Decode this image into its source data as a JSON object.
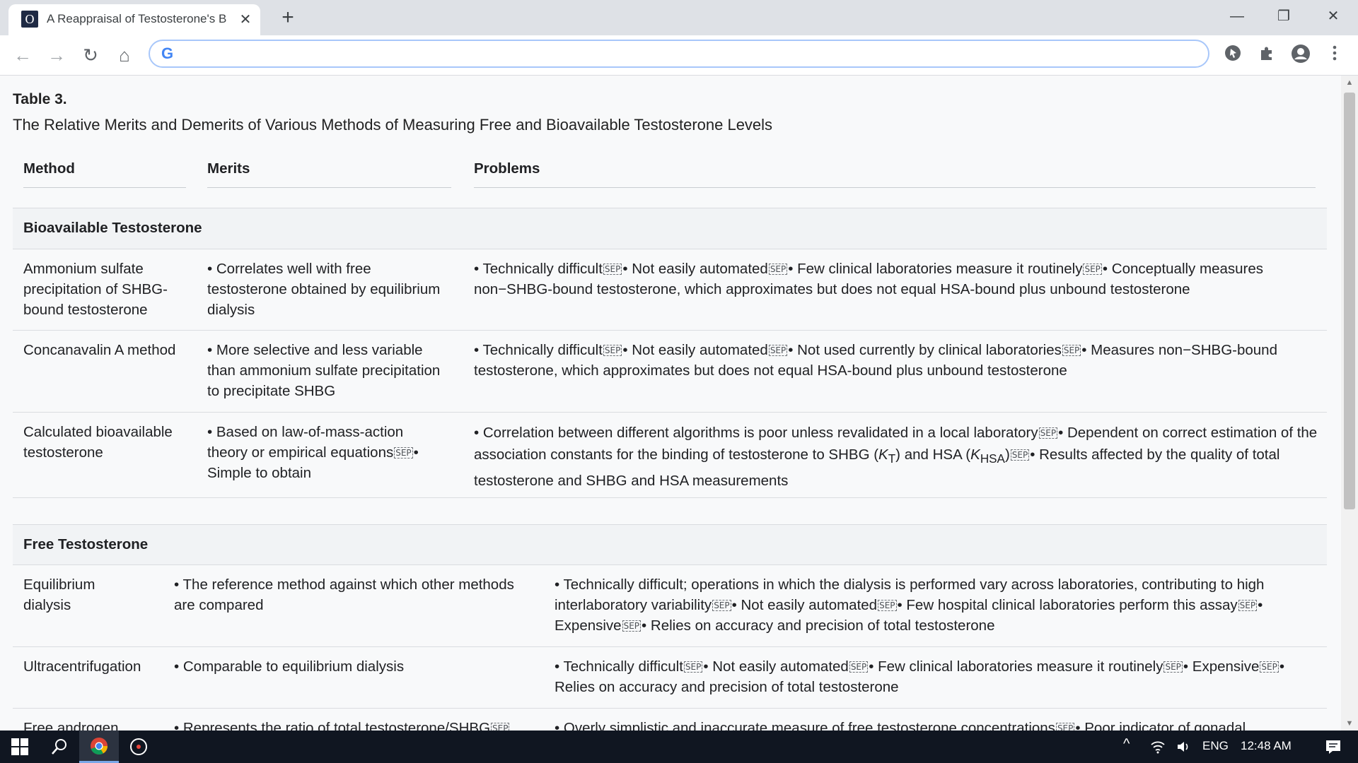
{
  "browser": {
    "tab": {
      "favicon_letter": "O",
      "title": "A Reappraisal of Testosterone's B",
      "close_glyph": "✕"
    },
    "new_tab_glyph": "+",
    "window_controls": {
      "minimize_glyph": "—",
      "restore_glyph": "❐",
      "close_glyph": "✕"
    },
    "nav": {
      "back_glyph": "←",
      "forward_glyph": "→",
      "reload_glyph": "↻",
      "home_glyph": "⌂"
    },
    "omnibox": {
      "google_glyph": "G",
      "value": "",
      "placeholder": ""
    },
    "toolbar_icons": [
      "cursor-extension-icon",
      "puzzle-icon",
      "profile-icon",
      "kebab-menu-icon"
    ]
  },
  "page": {
    "table_title": "Table 3.",
    "table_caption": "The Relative Merits and Demerits of Various Methods of Measuring Free and Bioavailable Testosterone Levels",
    "headers": {
      "method": "Method",
      "merits": "Merits",
      "problems": "Problems"
    },
    "sep_glyph": "SEP",
    "sections": [
      {
        "label": "Bioavailable Testosterone",
        "rows": [
          {
            "method": "Ammonium sulfate precipitation of SHBG-bound testosterone",
            "merits": [
              "Correlates well with free testosterone obtained by equilibrium dialysis"
            ],
            "problems": [
              "Technically difficult",
              "Not easily automated",
              "Few clinical laboratories measure it routinely",
              "Conceptually measures non−SHBG-bound testosterone, which approximates but does not equal HSA-bound plus unbound testosterone"
            ]
          },
          {
            "method": "Concanavalin A method",
            "merits": [
              "More selective and less variable than ammonium sulfate precipitation to precipitate SHBG"
            ],
            "problems": [
              "Technically difficult",
              "Not easily automated",
              "Not used currently by clinical laboratories",
              "Measures non−SHBG-bound testosterone, which approximates but does not equal HSA-bound plus unbound testosterone"
            ]
          },
          {
            "method": "Calculated bioavailable testosterone",
            "merits": [
              "Based on law-of-mass-action theory or empirical equations",
              "Simple to obtain"
            ],
            "problems_parts": {
              "p1": "Correlation between different algorithms is poor unless revalidated in a local laboratory",
              "p2a": "Dependent on correct estimation of the association constants for the binding of testosterone to SHBG (",
              "kt": "K",
              "kt_sub": "T",
              "p2b": ") and HSA (",
              "khsa": "K",
              "khsa_sub": "HSA",
              "p2c": ")",
              "p3": "Results affected by the quality of total testosterone and SHBG and HSA measurements"
            }
          }
        ]
      },
      {
        "label": "Free Testosterone",
        "rows": [
          {
            "method": "Equilibrium dialysis",
            "merits": [
              "The reference method against which other methods are compared"
            ],
            "problems": [
              "Technically difficult; operations in which the dialysis is performed vary across laboratories, contributing to high interlaboratory variability",
              "Not easily automated",
              "Few hospital clinical laboratories perform this assay",
              "Expensive",
              "Relies on accuracy and precision of total testosterone"
            ]
          },
          {
            "method": "Ultracentrifugation",
            "merits": [
              "Comparable to equilibrium dialysis"
            ],
            "problems": [
              "Technically difficult",
              "Not easily automated",
              "Few clinical laboratories measure it routinely",
              "Expensive",
              "Relies on accuracy and precision of total testosterone"
            ]
          },
          {
            "method": "Free androgen",
            "merits": [
              "Represents the ratio of total testosterone/SHBG"
            ],
            "problems": [
              "Overly simplistic and inaccurate measure of free testosterone concentrations",
              "Poor indicator of gonadal"
            ]
          }
        ]
      }
    ]
  },
  "taskbar": {
    "windows_glyph": "⊞",
    "search_glyph": "⚲",
    "tray_caret": "^",
    "language": "ENG",
    "time": "12:48 AM",
    "notification_glyph": "▤"
  }
}
